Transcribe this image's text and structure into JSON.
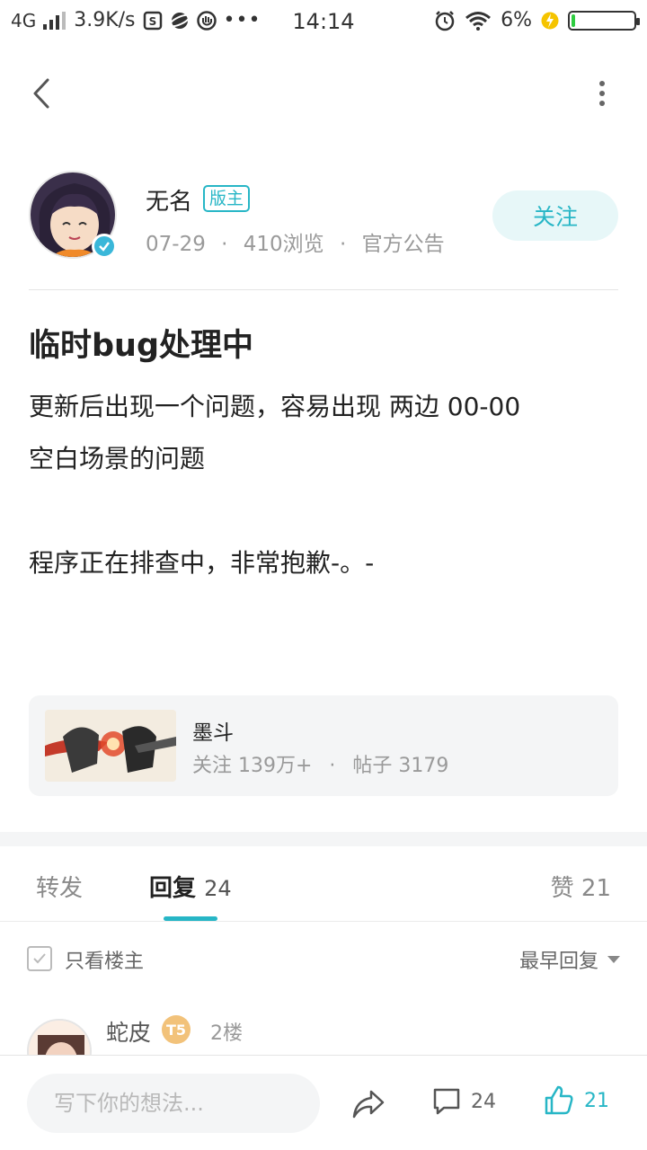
{
  "status_bar": {
    "network": "4G",
    "speed": "3.9K/s",
    "time": "14:14",
    "battery_percent": "6%",
    "battery_level": 0.06,
    "icons": [
      "signal-icon",
      "app-notify-icon",
      "planet-icon",
      "hand-icon",
      "more-dots-icon",
      "alarm-icon",
      "wifi-icon",
      "charging-icon",
      "battery-icon"
    ]
  },
  "nav": {
    "back_icon": "chevron-left-icon",
    "more_icon": "vertical-dots-icon"
  },
  "author": {
    "name": "无名",
    "role_badge": "版主",
    "date": "07-29",
    "views": "410浏览",
    "category": "官方公告",
    "separator": "·",
    "follow_label": "关注"
  },
  "post": {
    "title": "临时bug处理中",
    "body": [
      "更新后出现一个问题，容易出现 两边 00-00",
      "空白场景的问题",
      "",
      "程序正在排查中，非常抱歉-。-"
    ]
  },
  "game_card": {
    "name": "墨斗",
    "followers": "关注 139万+",
    "separator": "·",
    "posts": "帖子 3179"
  },
  "tabs": {
    "forward": "转发",
    "reply": "回复",
    "reply_count": "24",
    "like": "赞",
    "like_count": "21"
  },
  "filter": {
    "only_op": "只看楼主",
    "sort": "最早回复"
  },
  "comment": {
    "name": "蛇皮",
    "level": "T5",
    "floor": "2楼"
  },
  "bottom_bar": {
    "placeholder": "写下你的想法...",
    "comment_count": "24",
    "like_count": "21"
  },
  "colors": {
    "accent": "#27b6c6",
    "text": "#222222",
    "muted": "#9a9a9a",
    "card_bg": "#f4f5f6"
  }
}
